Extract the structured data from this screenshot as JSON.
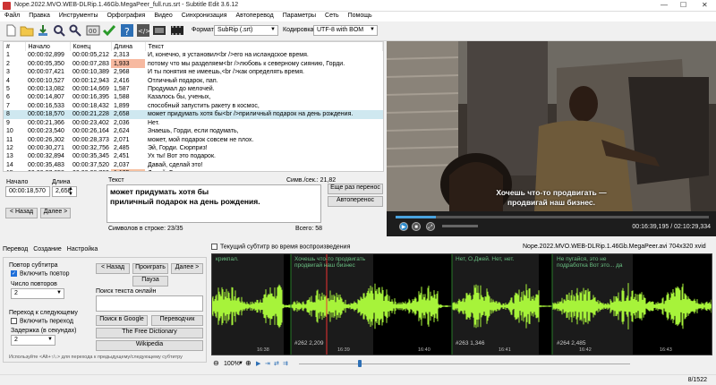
{
  "window": {
    "title": "Nope.2022.MVO.WEB-DLRip.1.46Gb.MegaPeer_full.rus.srt - Subtitle Edit 3.6.12",
    "minimize": "—",
    "maximize": "☐",
    "close": "✕"
  },
  "menu": [
    "Файл",
    "Правка",
    "Инструменты",
    "Орфография",
    "Видео",
    "Синхронизация",
    "Автоперевод",
    "Параметры",
    "Сеть",
    "Помощь"
  ],
  "toolbar": {
    "format_label": "Формат",
    "format_value": "SubRip (.srt)",
    "encoding_label": "Кодировка",
    "encoding_value": "UTF-8 with BOM"
  },
  "grid": {
    "headers": [
      "#",
      "Начало",
      "Конец",
      "Длина",
      "Текст"
    ],
    "rows": [
      {
        "n": "1",
        "start": "00:00:02,899",
        "end": "00:00:05,212",
        "dur": "2,313",
        "text": "И, конечно, я установил<br />его на исландское время.",
        "warn": ""
      },
      {
        "n": "2",
        "start": "00:00:05,350",
        "end": "00:00:07,283",
        "dur": "1,933",
        "text": "потому что мы разделяем<br />любовь к северному сиянию, Горди.",
        "warn": "dur"
      },
      {
        "n": "3",
        "start": "00:00:07,421",
        "end": "00:00:10,389",
        "dur": "2,968",
        "text": "И ты понятия не имеешь,<br />как определять время.",
        "warn": ""
      },
      {
        "n": "4",
        "start": "00:00:10,527",
        "end": "00:00:12,943",
        "dur": "2,416",
        "text": "Отличный подарок, пап.",
        "warn": ""
      },
      {
        "n": "5",
        "start": "00:00:13,082",
        "end": "00:00:14,669",
        "dur": "1,587",
        "text": "Продумал до мелочей.",
        "warn": ""
      },
      {
        "n": "6",
        "start": "00:00:14,807",
        "end": "00:00:16,395",
        "dur": "1,588",
        "text": "Казалось бы, ученых,",
        "warn": ""
      },
      {
        "n": "7",
        "start": "00:00:16,533",
        "end": "00:00:18,432",
        "dur": "1,899",
        "text": "способный запустить ракету в космос,",
        "warn": ""
      },
      {
        "n": "8",
        "start": "00:00:18,570",
        "end": "00:00:21,228",
        "dur": "2,658",
        "text": "может придумать хотя бы<br />приличный подарок на день рождения.",
        "warn": "",
        "sel": true
      },
      {
        "n": "9",
        "start": "00:00:21,366",
        "end": "00:00:23,402",
        "dur": "2,036",
        "text": "Нет.",
        "warn": ""
      },
      {
        "n": "10",
        "start": "00:00:23,540",
        "end": "00:00:26,164",
        "dur": "2,624",
        "text": "Знаешь, Горди, если подумать,",
        "warn": ""
      },
      {
        "n": "11",
        "start": "00:00:26,302",
        "end": "00:00:28,373",
        "dur": "2,071",
        "text": "может, мой подарок совсем не плох.",
        "warn": ""
      },
      {
        "n": "12",
        "start": "00:00:30,271",
        "end": "00:00:32,756",
        "dur": "2,485",
        "text": "Эй, Горди. Сюрприз!",
        "warn": ""
      },
      {
        "n": "13",
        "start": "00:00:32,894",
        "end": "00:00:35,345",
        "dur": "2,451",
        "text": "Ух ты! Вот это подарок.",
        "warn": ""
      },
      {
        "n": "14",
        "start": "00:00:35,483",
        "end": "00:00:37,520",
        "dur": "2,037",
        "text": "Давай, сделай это!",
        "warn": ""
      },
      {
        "n": "15",
        "start": "00:00:37,658",
        "end": "00:00:38,763",
        "dur": "1,105",
        "text": "Давай, Горди.",
        "warn": "dur2"
      }
    ]
  },
  "edit": {
    "start_label": "Начало",
    "start_value": "00:00:18,570",
    "dur_label": "Длина",
    "dur_value": "2,658",
    "text_label": "Текст",
    "cps": "Симв./сек.: 21,82",
    "line1": "может придумать хотя бы",
    "line2": "приличный подарок на день рождения.",
    "chars_per_line": "Символов в строке: 23/35",
    "total": "Всего: 58",
    "prev_btn": "< Назад",
    "next_btn": "Далее >",
    "translate_btn": "Еще раз перенос",
    "autotranslate_btn": "Автоперенос"
  },
  "video": {
    "subtitle_line1": "Хочешь что-то продвигать —",
    "subtitle_line2": "продвигай наш бизнес.",
    "time": "00:16:39,195 / 02:10:29,334",
    "progress": 0.128
  },
  "tabs": [
    "Перевод",
    "Создание",
    "Настройка"
  ],
  "translate_panel": {
    "repeat_group": "Повтор субтитра",
    "repeat_enable": "Включить повтор",
    "repeat_count_label": "Число повторов",
    "repeat_count": "2",
    "goto_group": "Переход к следующему",
    "goto_enable": "Включить переход",
    "delay_label": "Задержка (в секундах)",
    "delay_value": "2",
    "btn_prev": "< Назад",
    "btn_play": "Проиграть",
    "btn_next": "Далее >",
    "btn_pause": "Пауза",
    "search_label": "Поиск текста онлайн",
    "btn_google": "Поиск в Google",
    "btn_translator": "Переводчик",
    "btn_dictionary": "The Free Dictionary",
    "btn_wikipedia": "Wikipedia",
    "hint": "Используйте <Alt+↑/↓> для перехода к предыдущему/следующему субтитру"
  },
  "wave": {
    "checkbox": "Текущий субтитр во время воспроизведения",
    "file_info": "Nope.2022.MVO.WEB-DLRip.1.46Gb.MegaPeer.avi 704x320 xvid",
    "seg_texts": [
      "крикпал.",
      "Хочешь что-то продвигать продвигай наш бизнес",
      "Нет, О.Джей. Нет, нет.",
      "Не пугайся, это не подработка Вот это... да"
    ],
    "labels": [
      "#262  2,209",
      "#263  1,346",
      "#264  2,485"
    ],
    "ticks": [
      "16:38",
      "16:39",
      "16:40",
      "16:41",
      "16:42",
      "16:43",
      "16:44"
    ],
    "zoom": "100%"
  },
  "status": {
    "position": "8/1522"
  }
}
